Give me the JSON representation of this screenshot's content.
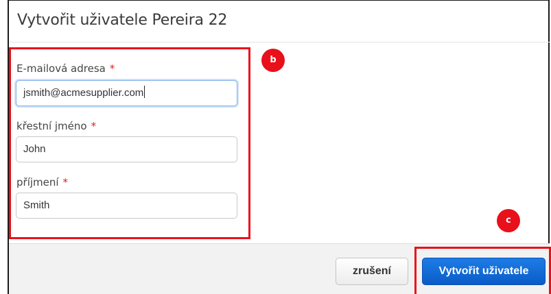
{
  "dialog": {
    "title": "Vytvořit uživatele Pereira 22"
  },
  "form": {
    "email": {
      "label": "E-mailová adresa",
      "required_mark": "*",
      "value": "jsmith@acmesupplier.com"
    },
    "first_name": {
      "label": "křestní jméno",
      "required_mark": "*",
      "value": "John"
    },
    "last_name": {
      "label": "příjmení",
      "required_mark": "*",
      "value": "Smith"
    }
  },
  "annotations": {
    "badge_b": "b",
    "badge_c": "c"
  },
  "footer": {
    "cancel_label": "zrušení",
    "create_label": "Vytvořit uživatele"
  },
  "colors": {
    "annotation_red": "#e8101a",
    "primary_blue": "#0a5cc7",
    "required_asterisk": "#e02020"
  }
}
